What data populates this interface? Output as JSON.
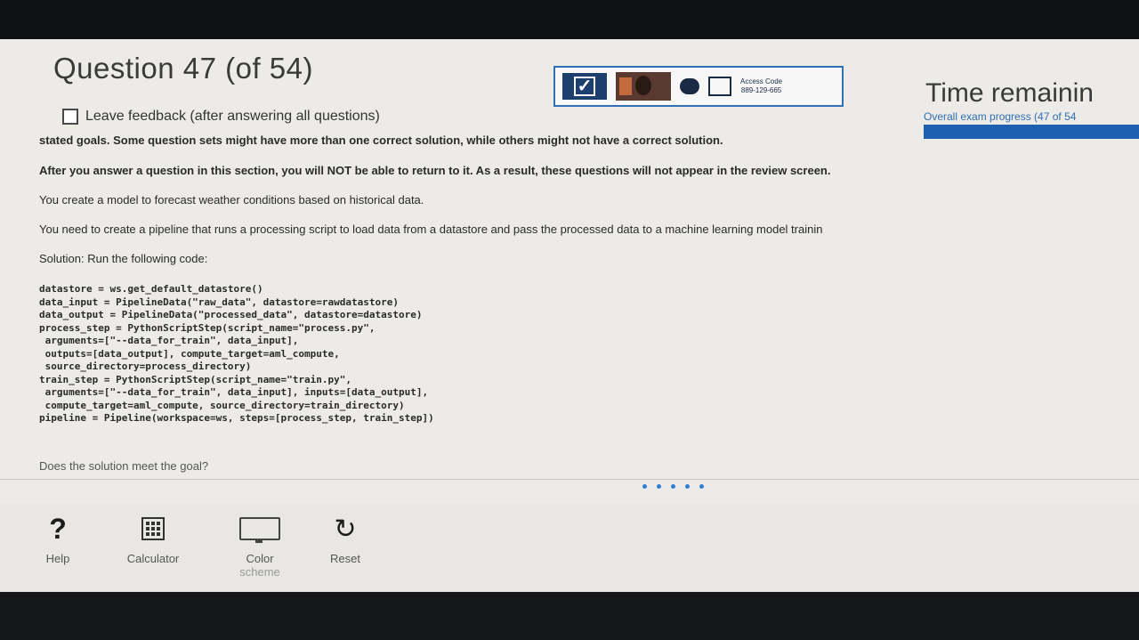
{
  "header": {
    "title": "Question 47 (of 54)",
    "feedback_label": "Leave feedback (after answering all questions)",
    "access_code_label": "Access Code",
    "access_code": "889-129-665",
    "time_label": "Time remainin",
    "progress_label": "Overall exam progress (47 of 54",
    "progress_fraction": 0.87
  },
  "content": {
    "line1": "stated goals. Some question sets might have more than one correct solution, while others might not have a correct solution.",
    "line2": "After you answer a question in this section, you will NOT be able to return to it. As a result, these questions will not appear in the review screen.",
    "line3": "You create a model to forecast weather conditions based on historical data.",
    "line4": "You need to create a pipeline that runs a processing script to load data from a datastore and pass the processed data to a machine learning model trainin",
    "line5": "Solution: Run the following code:",
    "code": [
      "datastore = ws.get_default_datastore()",
      "data_input = PipelineData(\"raw_data\", datastore=rawdatastore)",
      "data_output = PipelineData(\"processed_data\", datastore=datastore)",
      "process_step = PythonScriptStep(script_name=\"process.py\",",
      " arguments=[\"--data_for_train\", data_input],",
      " outputs=[data_output], compute_target=aml_compute,",
      " source_directory=process_directory)",
      "train_step = PythonScriptStep(script_name=\"train.py\",",
      " arguments=[\"--data_for_train\", data_input], inputs=[data_output],",
      " compute_target=aml_compute, source_directory=train_directory)",
      "pipeline = Pipeline(workspace=ws, steps=[process_step, train_step])"
    ],
    "question": "Does the solution meet the goal?"
  },
  "toolbar": {
    "help": "Help",
    "calculator": "Calculator",
    "color_scheme_1": "Color",
    "color_scheme_2": "scheme",
    "reset": "Reset"
  },
  "icons": [
    "checkmark-icon",
    "webcam-icon",
    "chat-icon",
    "whiteboard-icon",
    "help-icon",
    "calculator-icon",
    "monitor-icon",
    "reset-icon"
  ]
}
